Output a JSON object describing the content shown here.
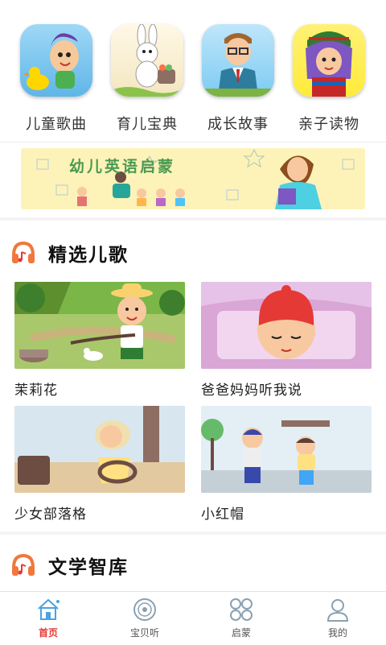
{
  "categories": [
    {
      "label": "儿童歌曲",
      "icon": "duck-boy-icon"
    },
    {
      "label": "育儿宝典",
      "icon": "rabbit-icon"
    },
    {
      "label": "成长故事",
      "icon": "teacher-icon"
    },
    {
      "label": "亲子读物",
      "icon": "girl-icon"
    }
  ],
  "banner": {
    "title": "幼儿英语启蒙"
  },
  "sections": {
    "songs": {
      "title": "精选儿歌"
    },
    "literature": {
      "title": "文学智库"
    }
  },
  "songs": [
    {
      "title": "茉莉花"
    },
    {
      "title": "爸爸妈妈听我说"
    },
    {
      "title": "少女部落格"
    },
    {
      "title": "小红帽"
    }
  ],
  "tabs": [
    {
      "label": "首页",
      "icon": "home-icon",
      "active": true
    },
    {
      "label": "宝贝听",
      "icon": "disc-icon",
      "active": false
    },
    {
      "label": "启蒙",
      "icon": "grid-icon",
      "active": false
    },
    {
      "label": "我的",
      "icon": "user-icon",
      "active": false
    }
  ],
  "colors": {
    "accent": "#e53935",
    "tab_icon_blue": "#4aa3e0",
    "banner_bg": "#fdf3b8"
  }
}
